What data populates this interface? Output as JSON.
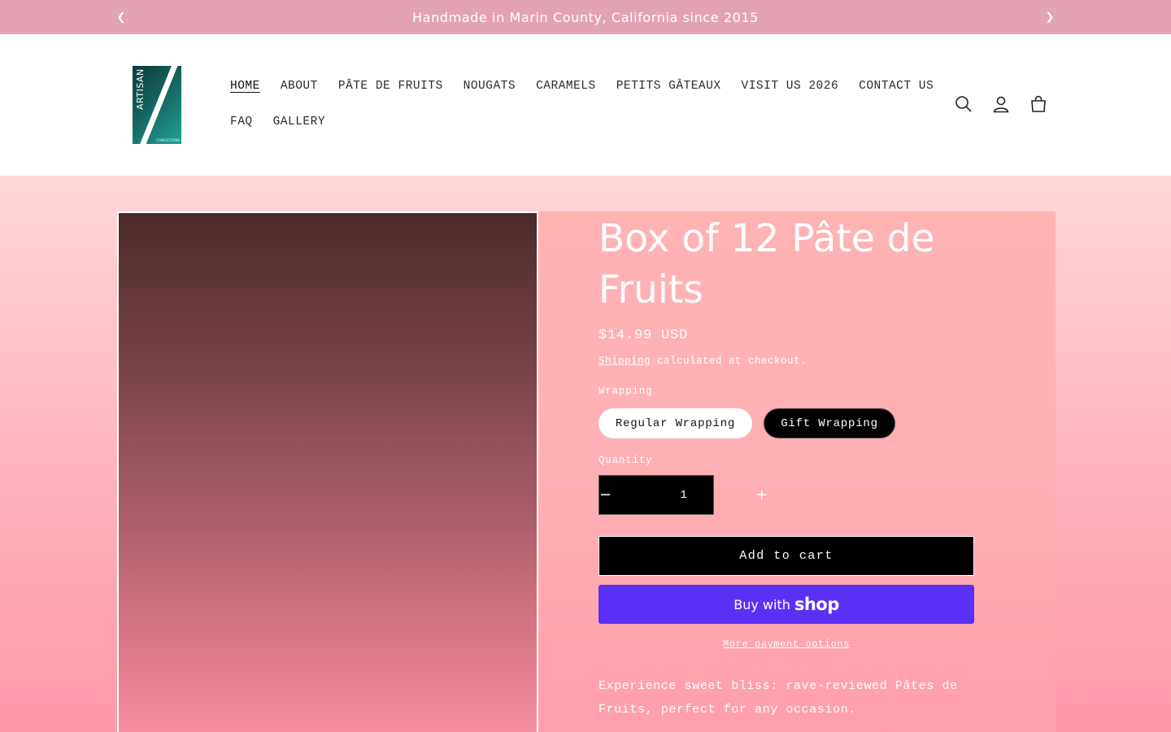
{
  "announcement": {
    "text": "Handmade in Marin County, California since 2015",
    "prev_icon": "chevron-left-icon",
    "next_icon": "chevron-right-icon"
  },
  "header": {
    "logo": {
      "text": "ARTISAN",
      "subtext": "CONFECTIONS"
    },
    "nav_row1": [
      "HOME",
      "ABOUT",
      "PÂTE DE FRUITS",
      "NOUGATS",
      "CARAMELS",
      "PETITS GÂTEAUX",
      "VISIT US 2026",
      "CONTACT US"
    ],
    "nav_row2": [
      "FAQ",
      "GALLERY"
    ],
    "active_nav": "HOME",
    "icons": [
      "search-icon",
      "account-icon",
      "cart-icon"
    ]
  },
  "product": {
    "title": "Box of 12 Pâte de Fruits",
    "price": "$14.99 USD",
    "shipping_link": "Shipping",
    "shipping_rest": " calculated at checkout.",
    "wrapping_label": "Wrapping",
    "wrapping_options": [
      "Regular Wrapping",
      "Gift Wrapping"
    ],
    "selected_wrapping": "Gift Wrapping",
    "quantity_label": "Quantity",
    "quantity": "1",
    "add_to_cart": "Add to cart",
    "buy_with": "Buy with",
    "shop_brand": "shop",
    "more_payment": "More payment options",
    "description": "Experience sweet bliss: rave-reviewed Pâtes de Fruits, perfect for any occasion."
  },
  "colors": {
    "announcement_bg": "#e3a3b2",
    "shop_pay": "#5a31f4",
    "logo_teal": "#15635e"
  }
}
